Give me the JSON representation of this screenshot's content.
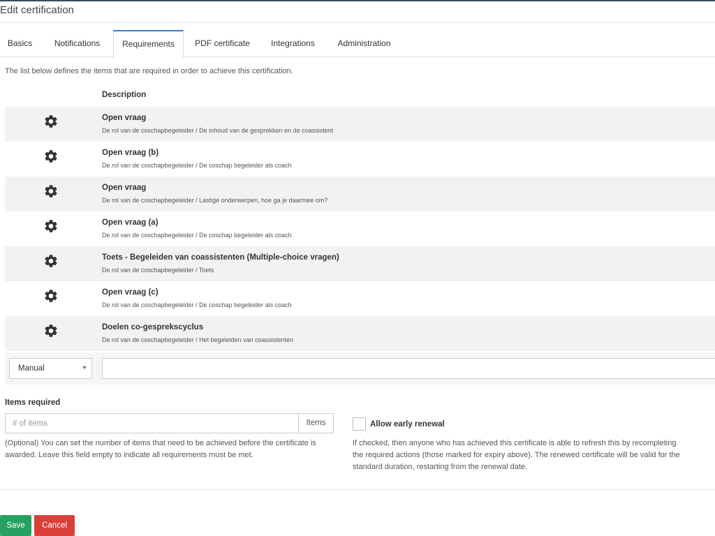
{
  "page": {
    "title": "Edit certification"
  },
  "tabs": [
    {
      "label": "Basics"
    },
    {
      "label": "Notifications"
    },
    {
      "label": "Requirements"
    },
    {
      "label": "PDF certificate"
    },
    {
      "label": "Integrations"
    },
    {
      "label": "Administration"
    }
  ],
  "active_tab": "Requirements",
  "requirements": {
    "intro": "The list below defines the items that are required in order to achieve this certification.",
    "column_header": "Description",
    "items": [
      {
        "title": "Open vraag",
        "path": "De rol van de coschapbegeleider / De inhoud van de gesprekken en de coassistent",
        "icon": "gear-icon"
      },
      {
        "title": "Open vraag (b)",
        "path": "De rol van de coschapbegeleider / De coschap begeleider als coach",
        "icon": "gear-icon"
      },
      {
        "title": "Open vraag",
        "path": "De rol van de coschapbegeleider / Lastige onderwerpen, hoe ga je daarmee om?",
        "icon": "gear-icon"
      },
      {
        "title": "Open vraag (a)",
        "path": "De rol van de coschapbegeleider / De coschap begeleider als coach",
        "icon": "gear-icon"
      },
      {
        "title": "Toets - Begeleiden van coassistenten (Multiple-choice vragen)",
        "path": "De rol van de coschapbegeleider / Toets",
        "icon": "gear-icon"
      },
      {
        "title": "Open vraag (c)",
        "path": "De rol van de coschapbegeleider / De coschap begeleider als coach",
        "icon": "gear-icon"
      },
      {
        "title": "Doelen co-gesprekscyclus",
        "path": "De rol van de coschapbegeleider / Het begeleiden van coassistenten",
        "icon": "gear-icon"
      }
    ],
    "add_type_select": {
      "value": "Manual"
    },
    "add_input": {
      "value": ""
    }
  },
  "items_required": {
    "label": "Items required",
    "placeholder": "# of items",
    "addon": "Items",
    "help": "(Optional) You can set the number of items that need to be achieved before the certificate is awarded. Leave this field empty to indicate all requirements must be met."
  },
  "early_renewal": {
    "label": "Allow early renewal",
    "checked": false,
    "help": "If checked, then anyone who has achieved this certificate is able to refresh this by recompleting the required actions (those marked for expiry above). The renewed certificate will be valid for the standard duration, restarting from the renewal date."
  },
  "actions": {
    "save_label": "Save",
    "cancel_label": "Cancel"
  },
  "colors": {
    "tab_accent": "#2f7fc1",
    "save": "#27a162",
    "cancel": "#d9403a",
    "row_shade": "#f2f2f2"
  }
}
